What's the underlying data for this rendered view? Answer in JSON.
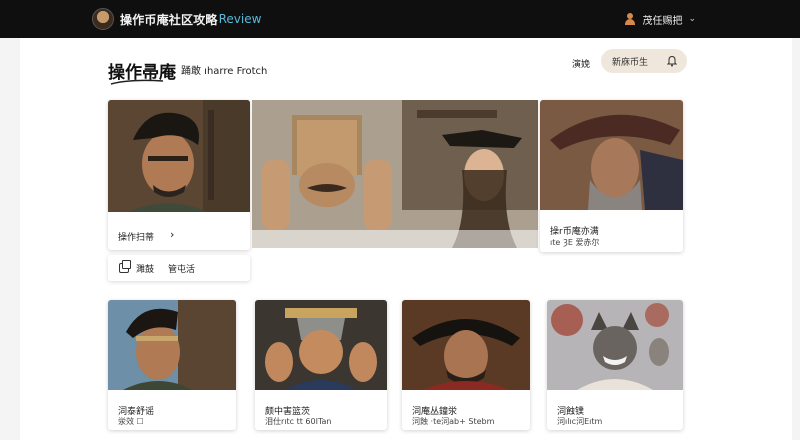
{
  "header": {
    "brand": "操作币庵社区攻略",
    "brand_accent": "Review",
    "user_label": "茂任赐把",
    "chevron": "⌄"
  },
  "page": {
    "title": "操作帚庵",
    "subnav": "踊敢 ıharre Frotch",
    "head_link": "演娩",
    "search_text": "新庥币生"
  },
  "cards": [
    {
      "caption": "操作扫蒂",
      "arrow": "›"
    },
    {
      "caption": "操r币庵亦满",
      "caption2": "ıte ȜE 爱赤尔"
    },
    {
      "caption": "泀泰舒谣",
      "caption2": "泶效 ☐"
    },
    {
      "caption": "颇中害篮茨",
      "caption2": "泪仕rıtc tt 60ITan"
    },
    {
      "caption": "泀庵丛鐘泶",
      "caption2": "泀蝕 ·te泀ab+ Stebm"
    },
    {
      "caption": "泀蝕镤",
      "caption2": "泀ılıc泀Eıtm"
    }
  ],
  "mini": {
    "label_a": "濉鼓",
    "label_b": "管屯活"
  },
  "icons": [
    "user-icon",
    "chevron-down-icon",
    "bell-icon",
    "copy-icon",
    "chevron-right-icon"
  ],
  "colors": {
    "topbar": "#0f0f0f",
    "accent": "#5bb8d8",
    "search_bg": "#efe7db"
  }
}
